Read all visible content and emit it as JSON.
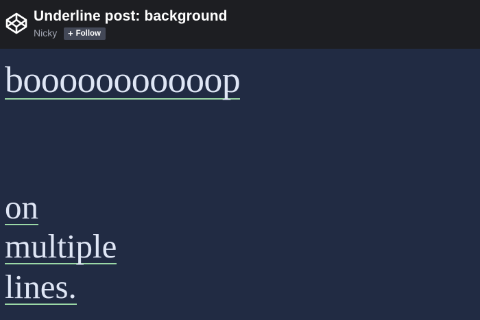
{
  "header": {
    "title": "Underline post: background",
    "author": "Nicky",
    "follow_label": "Follow",
    "follow_icon": "plus-icon",
    "logo_icon": "codepen-logo-icon"
  },
  "content": {
    "line1": "booooooooooop",
    "line2": "on",
    "line3": "multiple",
    "line4": "lines."
  },
  "colors": {
    "header_bg": "#1d1e22",
    "page_bg": "#212b43",
    "text": "#dfe6f5",
    "underline": "#9bd8a6",
    "follow_bg": "#434857"
  }
}
